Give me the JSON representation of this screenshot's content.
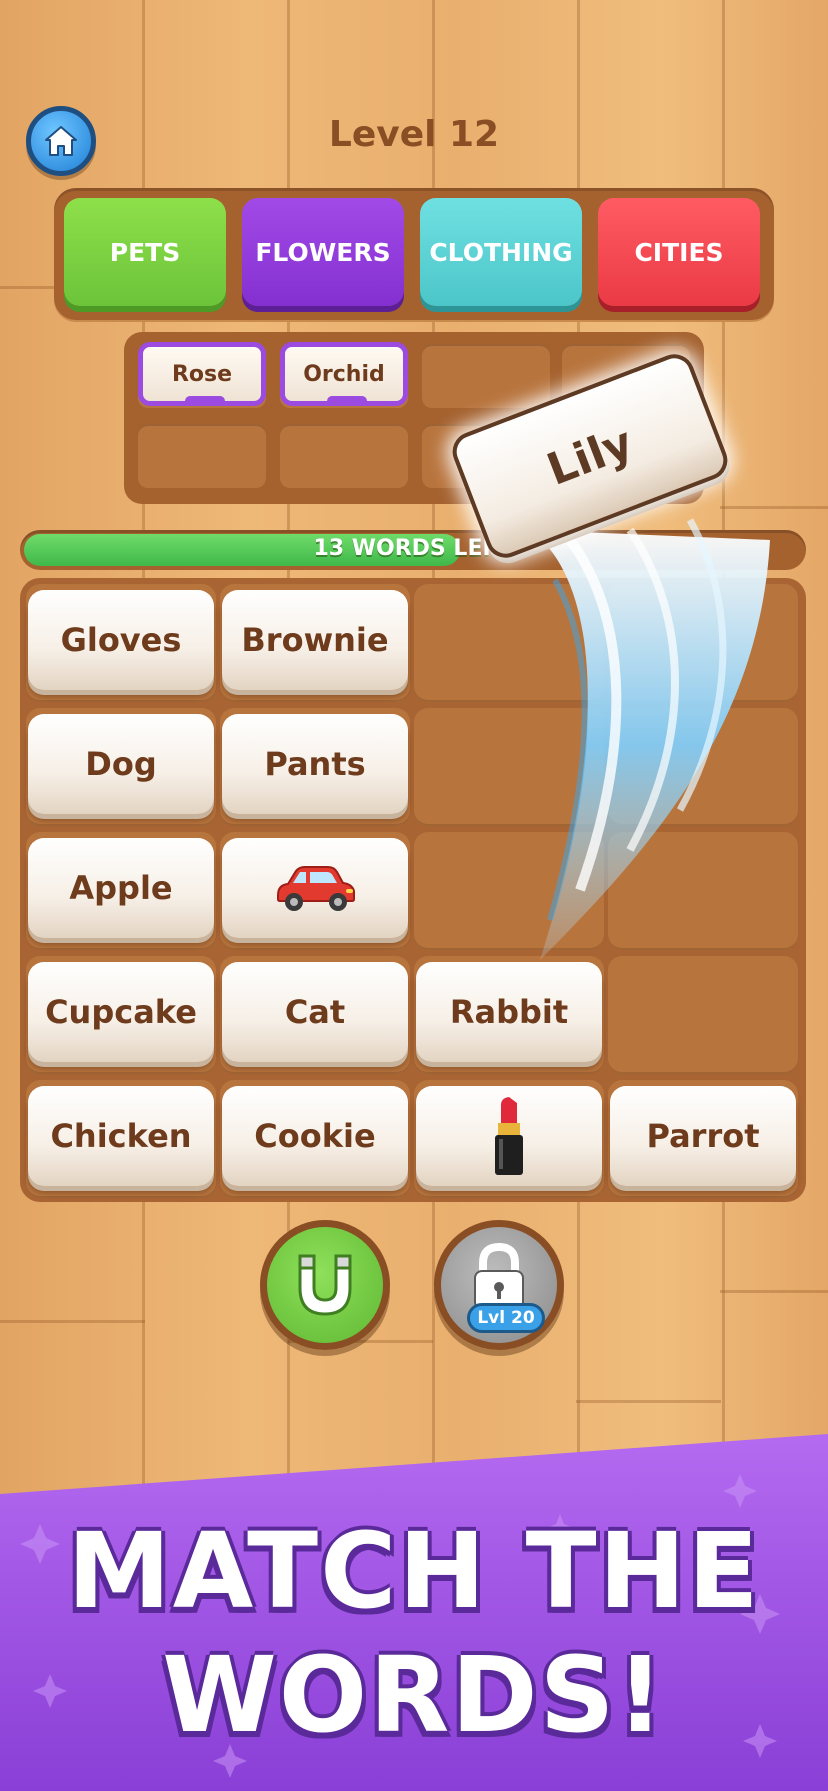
{
  "header": {
    "level_title": "Level 12"
  },
  "categories": [
    {
      "label": "PETS",
      "color": "#79cf3b"
    },
    {
      "label": "FLOWERS",
      "color": "#8e36d8"
    },
    {
      "label": "CLOTHING",
      "color": "#56cfd2"
    },
    {
      "label": "CITIES",
      "color": "#f0454f"
    }
  ],
  "slots": {
    "filled": [
      "Rose",
      "Orchid"
    ],
    "total": 8,
    "category_color": "#9b4be0"
  },
  "progress": {
    "label": "13 WORDS LEFT",
    "fill_fraction": 0.56
  },
  "flying_card": {
    "label": "Lily"
  },
  "board": {
    "rows": [
      [
        "Gloves",
        "Brownie",
        "",
        ""
      ],
      [
        "Dog",
        "Pants",
        "",
        ""
      ],
      [
        "Apple",
        "car-icon",
        "",
        ""
      ],
      [
        "Cupcake",
        "Cat",
        "Rabbit",
        ""
      ],
      [
        "Chicken",
        "Cookie",
        "lipstick-icon",
        "Parrot"
      ]
    ]
  },
  "powerups": {
    "magnet": {
      "icon": "magnet-icon",
      "color": "#6cc43a"
    },
    "locked": {
      "icon": "lock-icon",
      "badge": "Lvl 20"
    }
  },
  "banner": {
    "line1": "MATCH THE",
    "line2": "WORDS!",
    "color": "#9a4ee0"
  }
}
